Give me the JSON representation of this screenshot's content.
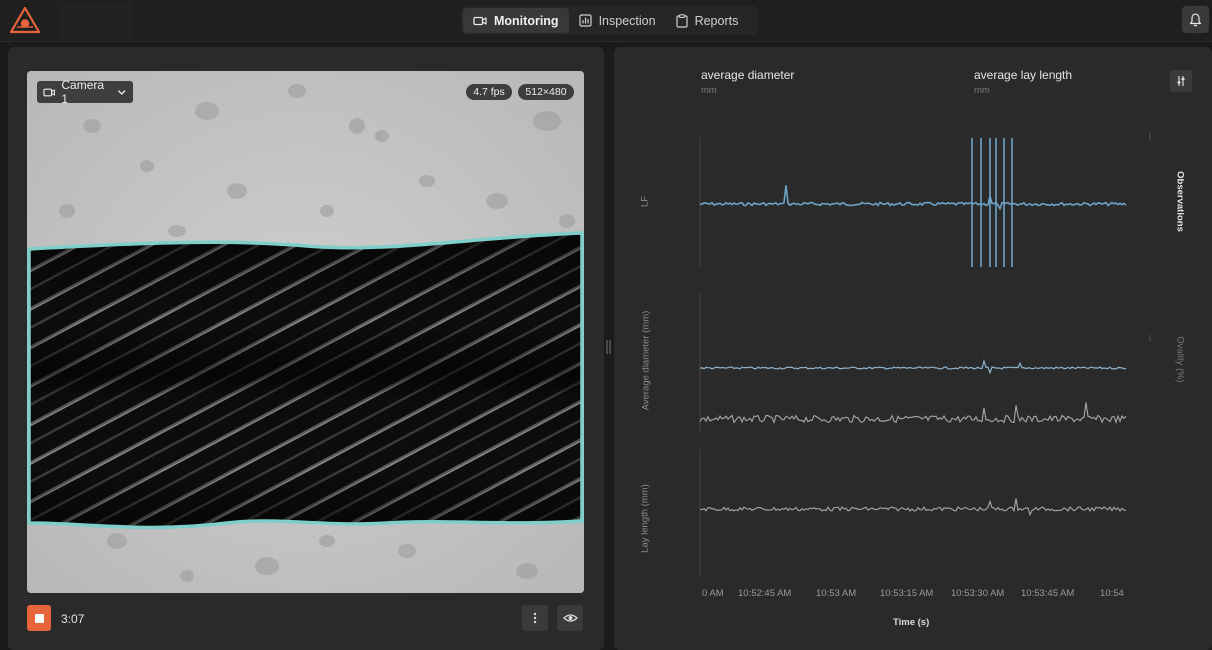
{
  "nav": {
    "tabs": [
      {
        "label": "Monitoring",
        "icon": "camera-icon",
        "active": true
      },
      {
        "label": "Inspection",
        "icon": "bar-chart-icon",
        "active": false
      },
      {
        "label": "Reports",
        "icon": "clipboard-icon",
        "active": false
      }
    ]
  },
  "camera": {
    "selected": "Camera 1",
    "fps": "4.7 fps",
    "resolution": "512×480"
  },
  "recording": {
    "elapsed": "3:07"
  },
  "metrics": [
    {
      "label": "average diameter",
      "unit": "mm"
    },
    {
      "label": "average lay length",
      "unit": "mm"
    }
  ],
  "charts": {
    "top_left_label": "LF",
    "top_right_label": "Observations",
    "middle_left_label": "Average diameter (mm)",
    "middle_right_label": "Ovality (%)",
    "bottom_left_label": "Lay length (mm)",
    "x_axis_title": "Time (s)",
    "x_ticks": [
      "0 AM",
      "10:52:45 AM",
      "10:53 AM",
      "10:53:15 AM",
      "10:53:30 AM",
      "10:53:45 AM",
      "10:54"
    ]
  },
  "colors": {
    "accent": "#e8643c",
    "series_blue": "#6ea3c8",
    "series_gray": "#a8a8a8",
    "outline_teal": "#7ecfc9"
  }
}
